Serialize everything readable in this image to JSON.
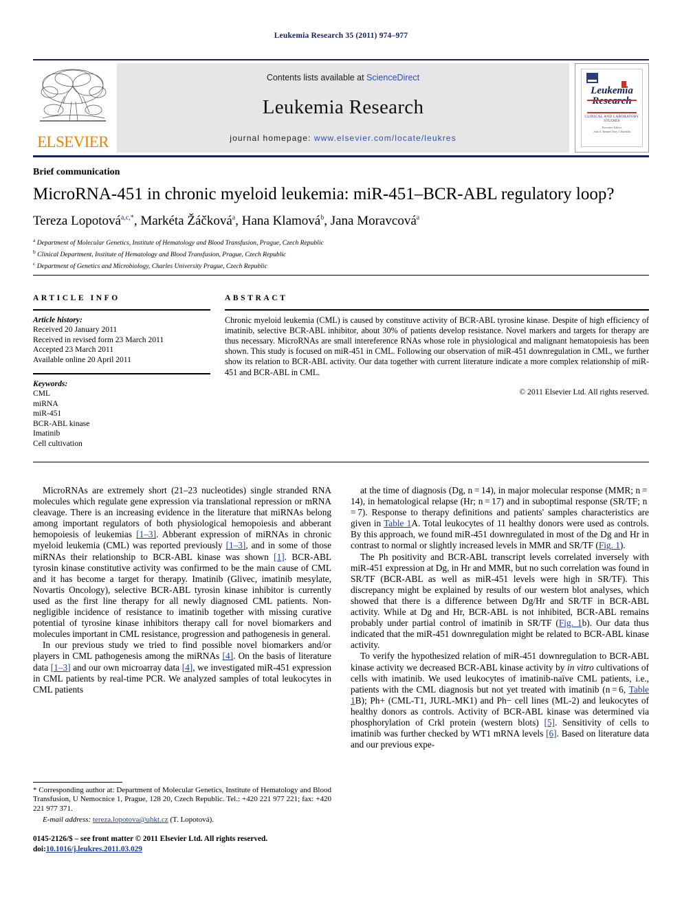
{
  "running_head": "Leukemia Research 35 (2011) 974–977",
  "masthead": {
    "contents_prefix": "Contents lists available at ",
    "sciencedirect": "ScienceDirect",
    "journal_title": "Leukemia Research",
    "homepage_prefix": "journal homepage: ",
    "homepage_url": "www.elsevier.com/locate/leukres",
    "publisher_logo_text": "ELSEVIER",
    "cover": {
      "title_line1": "Leukemia",
      "title_line2": "Research",
      "subtitle": "CLINICAL AND LABORATORY STUDIES",
      "meta_line1": "Executive Editors",
      "meta_line2": "John A. Bennett      Terry J. Hamblin"
    }
  },
  "article": {
    "type_label": "Brief communication",
    "title": "MicroRNA-451 in chronic myeloid leukemia: miR-451–BCR-ABL regulatory loop?",
    "authors": [
      {
        "name": "Tereza Lopotová",
        "sup": "a,c,*"
      },
      {
        "name": "Markéta Žáčková",
        "sup": "a"
      },
      {
        "name": "Hana Klamová",
        "sup": "b"
      },
      {
        "name": "Jana Moravcová",
        "sup": "a"
      }
    ],
    "affiliations": [
      {
        "marker": "a",
        "text": "Department of Molecular Genetics, Institute of Hematology and Blood Transfusion, Prague, Czech Republic"
      },
      {
        "marker": "b",
        "text": "Clinical Department, Institute of Hematology and Blood Transfusion, Prague, Czech Republic"
      },
      {
        "marker": "c",
        "text": "Department of Genetics and Microbiology, Charles University Prague, Czech Republic"
      }
    ]
  },
  "article_info": {
    "heading": "ARTICLE INFO",
    "history_title": "Article history:",
    "history": [
      "Received 20 January 2011",
      "Received in revised form 23 March 2011",
      "Accepted 23 March 2011",
      "Available online 20 April 2011"
    ],
    "keywords_title": "Keywords:",
    "keywords": [
      "CML",
      "miRNA",
      "miR-451",
      "BCR-ABL kinase",
      "Imatinib",
      "Cell cultivation"
    ]
  },
  "abstract": {
    "heading": "ABSTRACT",
    "text": "Chronic myeloid leukemia (CML) is caused by constituve activity of BCR-ABL tyrosine kinase. Despite of high efficiency of imatinib, selective BCR-ABL inhibitor, about 30% of patients develop resistance. Novel markers and targets for therapy are thus necessary. MicroRNAs are small intereference RNAs whose role in physiological and malignant hematopoiesis has been shown. This study is focused on miR-451 in CML. Following our observation of miR-451 downregulation in CML, we further show its relation to BCR-ABL activity. Our data together with current literature indicate a more complex relationship of miR-451 and BCR-ABL in CML.",
    "copyright": "© 2011 Elsevier Ltd. All rights reserved."
  },
  "body": {
    "left": [
      {
        "segments": [
          {
            "t": "MicroRNAs are extremely short (21–23 nucleotides) single stranded RNA molecules which regulate gene expression via translational repression or mRNA cleavage. There is an increasing evidence in the literature that miRNAs belong among important regulators of both physiological hemopoiesis and abberant hemopoiesis of leukemias ",
            "k": "plain"
          },
          {
            "t": "[1–3]",
            "k": "ref"
          },
          {
            "t": ". Abberant expression of miRNAs in chronic myeloid leukemia (CML) was reported previously ",
            "k": "plain"
          },
          {
            "t": "[1–3]",
            "k": "ref"
          },
          {
            "t": ", and in some of those miRNAs their relationship to BCR-ABL kinase was shown ",
            "k": "plain"
          },
          {
            "t": "[1]",
            "k": "ref"
          },
          {
            "t": ". BCR-ABL tyrosin kinase constitutive activity was confirmed to be the main cause of CML and it has become a target for therapy. Imatinib (Glivec, imatinib mesylate, Novartis Oncology), selective BCR-ABL tyrosin kinase inhibitor is currently used as the first line therapy for all newly diagnosed CML patients. Non-negligible incidence of resistance to imatinib together with missing curative potential of tyrosine kinase inhibitors therapy call for novel biomarkers and molecules important in CML resistance, progression and pathogenesis in general.",
            "k": "plain"
          }
        ]
      },
      {
        "segments": [
          {
            "t": "In our previous study we tried to find possible novel biomarkers and/or players in CML pathogenesis among the miRNAs ",
            "k": "plain"
          },
          {
            "t": "[4]",
            "k": "ref"
          },
          {
            "t": ". On the basis of literature data ",
            "k": "plain"
          },
          {
            "t": "[1–3]",
            "k": "ref"
          },
          {
            "t": " and our own microarray data ",
            "k": "plain"
          },
          {
            "t": "[4]",
            "k": "ref"
          },
          {
            "t": ", we investigated miR-451 expression in CML patients by real-time PCR. We analyzed samples of total leukocytes in CML patients",
            "k": "plain"
          }
        ]
      }
    ],
    "right": [
      {
        "segments": [
          {
            "t": "at the time of diagnosis (Dg, n = 14), in major molecular response (MMR; n = 14), in hematological relapse (Hr; n = 17) and in suboptimal response (SR/TF; n = 7). Response to therapy definitions and patients' samples characteristics are given in ",
            "k": "plain"
          },
          {
            "t": "Table 1",
            "k": "ref"
          },
          {
            "t": "A. Total leukocytes of 11 healthy donors were used as controls. By this approach, we found miR-451 downregulated in most of the Dg and Hr in contrast to normal or slightly increased levels in MMR and SR/TF (",
            "k": "plain"
          },
          {
            "t": "Fig. 1",
            "k": "ref"
          },
          {
            "t": ").",
            "k": "plain"
          }
        ],
        "no_indent_first": false
      },
      {
        "segments": [
          {
            "t": "The Ph positivity and BCR-ABL transcript levels correlated inversely with miR-451 expression at Dg, in Hr and MMR, but no such correlation was found in SR/TF (BCR-ABL as well as miR-451 levels were high in SR/TF). This discrepancy might be explained by results of our western blot analyses, which showed that there is a difference between Dg/Hr and SR/TF in BCR-ABL activity. While at Dg and Hr, BCR-ABL is not inhibited, BCR-ABL remains probably under partial control of imatinib in SR/TF (",
            "k": "plain"
          },
          {
            "t": "Fig. 1",
            "k": "ref"
          },
          {
            "t": "b). Our data thus indicated that the miR-451 downregulation might be related to BCR-ABL kinase activity.",
            "k": "plain"
          }
        ]
      },
      {
        "segments": [
          {
            "t": "To verify the hypothesized relation of miR-451 downregulation to BCR-ABL kinase activity we decreased BCR-ABL kinase activity by ",
            "k": "plain"
          },
          {
            "t": "in vitro",
            "k": "italic"
          },
          {
            "t": " cultivations of cells with imatinib. We used leukocytes of imatinib-naïve CML patients, i.e., patients with the CML diagnosis but not yet treated with imatinib (n = 6, ",
            "k": "plain"
          },
          {
            "t": "Table 1",
            "k": "ref"
          },
          {
            "t": "B); Ph+ (CML-T1, JURL-MK1) and Ph− cell lines (ML-2) and leukocytes of healthy donors as controls. Activity of BCR-ABL kinase was determined via phosphorylation of Crkl protein (western blots) ",
            "k": "plain"
          },
          {
            "t": "[5]",
            "k": "ref"
          },
          {
            "t": ". Sensitivity of cells to imatinib was further checked by WT1 mRNA levels ",
            "k": "plain"
          },
          {
            "t": "[6]",
            "k": "ref"
          },
          {
            "t": ". Based on literature data and our previous expe-",
            "k": "plain"
          }
        ]
      }
    ]
  },
  "footnote": {
    "star": "*",
    "corresponding": " Corresponding author at: Department of Molecular Genetics, Institute of Hematology and Blood Transfusion, U Nemocnice 1, Prague, 128 20, Czech Republic. Tel.: +420 221 977 221; fax: +420 221 977 371.",
    "email_label": "E-mail address:",
    "email": "tereza.lopotova@uhkt.cz",
    "email_owner": " (T. Lopotová)."
  },
  "imprint": {
    "issn_line": "0145-2126/$ – see front matter © 2011 Elsevier Ltd. All rights reserved.",
    "doi_prefix": "doi:",
    "doi": "10.1016/j.leukres.2011.03.029"
  },
  "colors": {
    "brand_blue": "#13205e",
    "link_blue": "#1b3fa0",
    "elsevier_orange": "#f08000",
    "cover_red": "#c0392b"
  }
}
